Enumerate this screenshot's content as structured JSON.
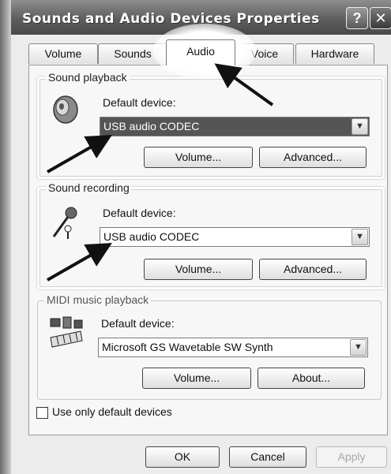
{
  "window": {
    "title": "Sounds and Audio Devices Properties",
    "help_glyph": "?",
    "close_glyph": "✕"
  },
  "tabs": [
    {
      "label": "Volume"
    },
    {
      "label": "Sounds"
    },
    {
      "label": "Audio",
      "active": true
    },
    {
      "label": "Voice"
    },
    {
      "label": "Hardware"
    }
  ],
  "playback": {
    "group_label": "Sound playback",
    "device_label": "Default device:",
    "selected": "USB audio CODEC",
    "volume_btn": "Volume...",
    "advanced_btn": "Advanced..."
  },
  "recording": {
    "group_label": "Sound recording",
    "device_label": "Default device:",
    "selected": "USB audio CODEC",
    "volume_btn": "Volume...",
    "advanced_btn": "Advanced..."
  },
  "midi": {
    "group_label": "MIDI music playback",
    "device_label": "Default device:",
    "selected": "Microsoft GS Wavetable SW Synth",
    "volume_btn": "Volume...",
    "about_btn": "About..."
  },
  "options": {
    "default_only_label": "Use only default devices",
    "default_only_checked": false
  },
  "footer": {
    "ok": "OK",
    "cancel": "Cancel",
    "apply": "Apply"
  },
  "icons": {
    "speaker": "speaker-icon",
    "mic": "microphone-icon",
    "midi": "midi-keyboard-icon",
    "dropdown": "chevron-down-icon",
    "annotation": "arrow-annotation"
  }
}
